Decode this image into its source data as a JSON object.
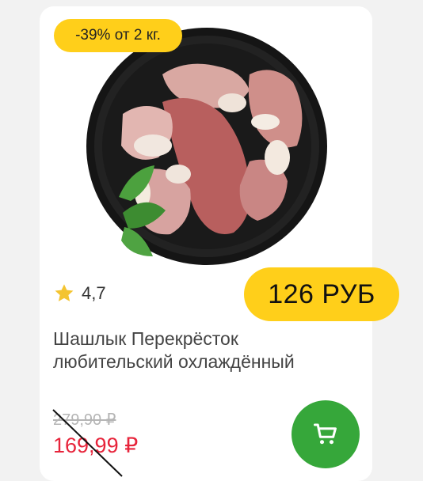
{
  "product": {
    "discount_badge": "-39% от 2 кг.",
    "rating": "4,7",
    "price_pill": "126 РУБ",
    "title": "Шашлык Перекрёсток любительский охлаждённый",
    "old_price": "279,90 ₽",
    "new_price": "169,99 ₽"
  },
  "icons": {
    "rating": "star-icon",
    "cart": "shopping-cart-icon"
  },
  "colors": {
    "accent_yellow": "#ffcf1a",
    "price_red": "#e7243b",
    "cart_green": "#36a73a",
    "old_price_gray": "#b5b5b5"
  }
}
